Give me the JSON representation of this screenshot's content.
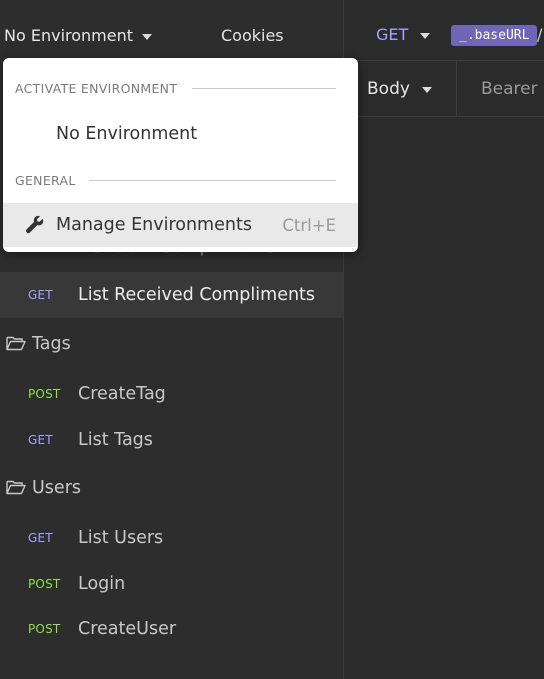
{
  "sidebar": {
    "environment_label": "No Environment",
    "cookies_label": "Cookies",
    "ghost_item": {
      "method": "GET",
      "label": "List Sent Compliments"
    },
    "active_item": {
      "method": "GET",
      "label": "List Received Compliments"
    },
    "folders": [
      {
        "name": "Tags",
        "requests": [
          {
            "method": "POST",
            "label": "CreateTag"
          },
          {
            "method": "GET",
            "label": "List Tags"
          }
        ]
      },
      {
        "name": "Users",
        "requests": [
          {
            "method": "GET",
            "label": "List Users"
          },
          {
            "method": "POST",
            "label": "Login"
          },
          {
            "method": "POST",
            "label": "CreateUser"
          }
        ]
      }
    ]
  },
  "request": {
    "method": "GET",
    "base_url_tag": "_.baseURL",
    "url_suffix": "/",
    "tabs": {
      "body": "Body",
      "auth": "Bearer"
    }
  },
  "env_dropdown": {
    "section_activate": "ACTIVATE ENVIRONMENT",
    "no_env_option": "No Environment",
    "section_general": "GENERAL",
    "manage_label": "Manage Environments",
    "manage_shortcut": "Ctrl+E"
  },
  "colors": {
    "get_method": "#a6a2ff",
    "post_method": "#8be24a",
    "base_url_tag_bg": "#7165b8",
    "sidebar_bg": "#2d2d2d",
    "active_row_bg": "#383838"
  }
}
